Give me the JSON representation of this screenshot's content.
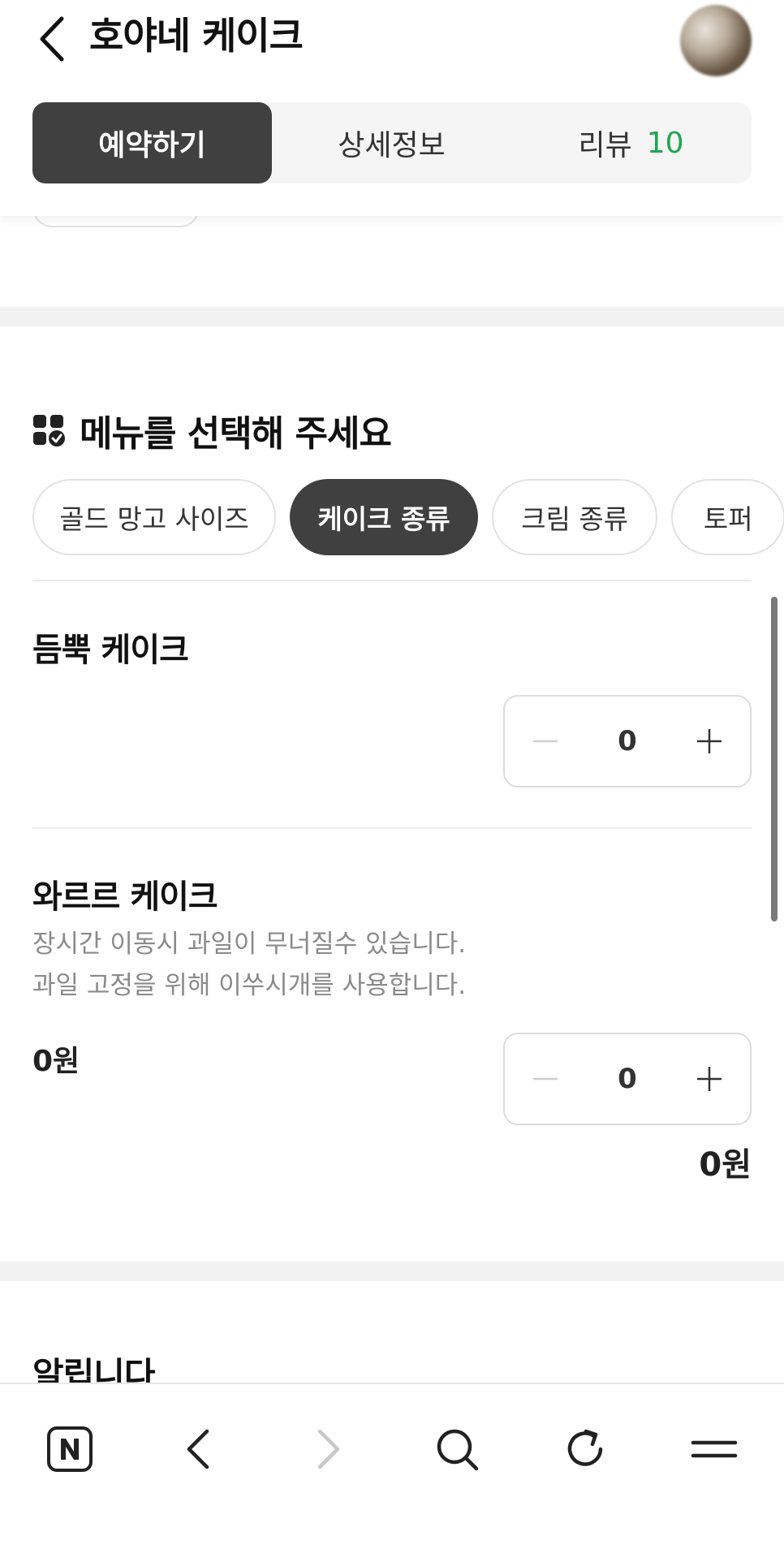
{
  "header": {
    "title": "호야네 케이크"
  },
  "tabs": [
    {
      "label": "예약하기",
      "active": true
    },
    {
      "label": "상세정보",
      "active": false
    },
    {
      "label": "리뷰",
      "count": "10",
      "active": false
    }
  ],
  "menu_section": {
    "title": "메뉴를 선택해 주세요",
    "categories": [
      {
        "label": "골드 망고 사이즈",
        "active": false
      },
      {
        "label": "케이크 종류",
        "active": true
      },
      {
        "label": "크림 종류",
        "active": false
      },
      {
        "label": "토퍼",
        "active": false
      }
    ]
  },
  "items": [
    {
      "name": "듬뿍 케이크",
      "quantity": "0"
    },
    {
      "name": "와르르 케이크",
      "description_line1": "장시간 이동시 과일이 무너질수 있습니다.",
      "description_line2": "과일 고정을 위해 이쑤시개를 사용합니다.",
      "price": "0원",
      "quantity": "0",
      "total": "0원"
    }
  ],
  "notice_section": {
    "title": "알립니다"
  },
  "colors": {
    "active_tab_bg": "#404040",
    "review_count": "#1ea64f",
    "divider_band": "#f2f2f2"
  },
  "icons": {
    "back": "chevron-left-icon",
    "menu_title": "menu-grid-check-icon",
    "nav": [
      "naver-home-icon",
      "nav-back-icon",
      "nav-forward-icon",
      "search-icon",
      "refresh-icon",
      "hamburger-menu-icon"
    ]
  }
}
